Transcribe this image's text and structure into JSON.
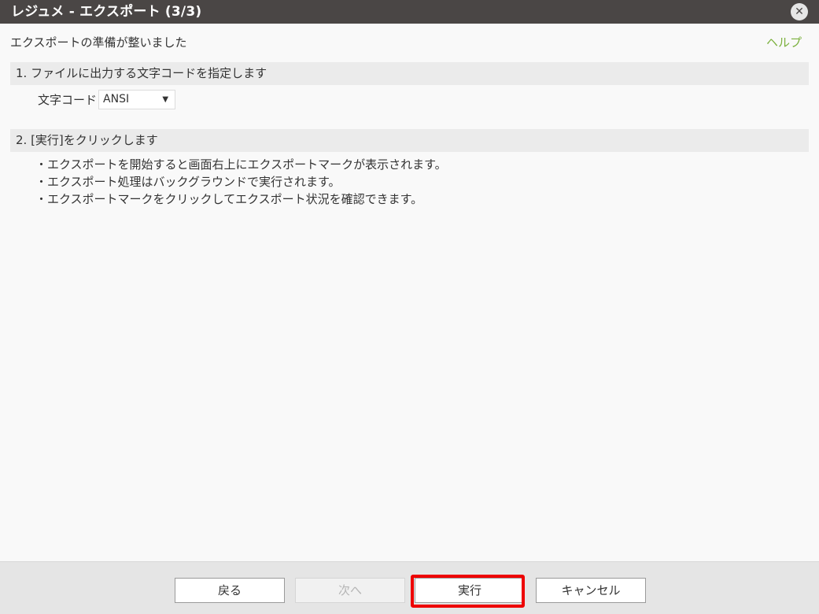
{
  "dialog": {
    "title": "レジュメ - エクスポート (3/3)",
    "close_label": "✕"
  },
  "status": {
    "message": "エクスポートの準備が整いました",
    "help_label": "ヘルプ"
  },
  "step1": {
    "heading": "1. ファイルに出力する文字コードを指定します",
    "encoding_label": "文字コード",
    "encoding_value": "ANSI",
    "dropdown_arrow": "▼"
  },
  "step2": {
    "heading": "2. [実行]をクリックします",
    "notes": [
      "・エクスポートを開始すると画面右上にエクスポートマークが表示されます。",
      "・エクスポート処理はバックグラウンドで実行されます。",
      "・エクスポートマークをクリックしてエクスポート状況を確認できます。"
    ]
  },
  "footer": {
    "back_label": "戻る",
    "next_label": "次へ",
    "run_label": "実行",
    "cancel_label": "キャンセル"
  },
  "icons": {
    "close": "close-icon",
    "dropdown": "chevron-down-icon"
  },
  "colors": {
    "titlebar": "#4a4645",
    "help_link": "#7ab03c",
    "highlight": "#ee0000"
  }
}
